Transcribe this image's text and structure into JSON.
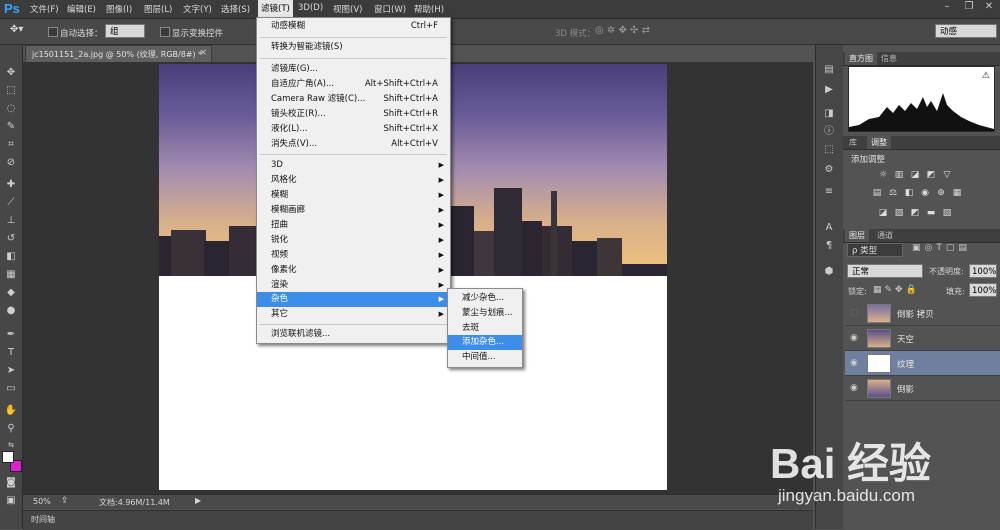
{
  "menubar": {
    "logo": "Ps",
    "items": [
      "文件(F)",
      "编辑(E)",
      "图像(I)",
      "图层(L)",
      "文字(Y)",
      "选择(S)",
      "滤镜(T)",
      "3D(D)",
      "视图(V)",
      "窗口(W)",
      "帮助(H)"
    ],
    "active_index": 6
  },
  "options": {
    "auto_select_label": "自动选择：",
    "auto_select_value": "组",
    "show_transform_label": "显示变换控件",
    "mode_3d_label": "3D 模式：",
    "workspace_value": "动感"
  },
  "document": {
    "tab_title": "jc1501151_2a.jpg @ 50% (纹理, RGB/8#) *",
    "tab_close": "×"
  },
  "statusbar": {
    "zoom": "50%",
    "doc_info": "文档:4.96M/11.4M"
  },
  "timeline": {
    "label": "时间轴"
  },
  "filter_menu": {
    "items": [
      {
        "label": "动感模糊",
        "shortcut": "Ctrl+F"
      },
      {
        "label": "转换为智能滤镜(S)",
        "shortcut": ""
      },
      {
        "label": "滤镜库(G)...",
        "shortcut": ""
      },
      {
        "label": "自适应广角(A)...",
        "shortcut": "Alt+Shift+Ctrl+A"
      },
      {
        "label": "Camera Raw 滤镜(C)...",
        "shortcut": "Shift+Ctrl+A"
      },
      {
        "label": "镜头校正(R)...",
        "shortcut": "Shift+Ctrl+R"
      },
      {
        "label": "液化(L)...",
        "shortcut": "Shift+Ctrl+X"
      },
      {
        "label": "消失点(V)...",
        "shortcut": "Alt+Ctrl+V"
      },
      {
        "label": "3D",
        "shortcut": ""
      },
      {
        "label": "风格化",
        "shortcut": ""
      },
      {
        "label": "模糊",
        "shortcut": ""
      },
      {
        "label": "模糊画廊",
        "shortcut": ""
      },
      {
        "label": "扭曲",
        "shortcut": ""
      },
      {
        "label": "锐化",
        "shortcut": ""
      },
      {
        "label": "视频",
        "shortcut": ""
      },
      {
        "label": "像素化",
        "shortcut": ""
      },
      {
        "label": "渲染",
        "shortcut": ""
      },
      {
        "label": "杂色",
        "shortcut": ""
      },
      {
        "label": "其它",
        "shortcut": ""
      },
      {
        "label": "浏览联机滤镜...",
        "shortcut": ""
      }
    ]
  },
  "noise_submenu": {
    "items": [
      "减少杂色...",
      "蒙尘与划痕...",
      "去斑",
      "添加杂色...",
      "中间值..."
    ],
    "highlight_index": 3
  },
  "panels": {
    "histogram_tabs": [
      "直方图",
      "信息"
    ],
    "adjust_tabs": [
      "库",
      "调整"
    ],
    "adjust_title": "添加调整",
    "layers_tabs": [
      "图层",
      "通道"
    ],
    "kind_filter": "ρ 类型",
    "blend_mode": "正常",
    "opacity_label": "不透明度:",
    "opacity_value": "100%",
    "lock_label": "锁定:",
    "fill_label": "填充:",
    "fill_value": "100%",
    "layers": [
      {
        "name": "倒影 拷贝",
        "visible": false
      },
      {
        "name": "天空",
        "visible": true
      },
      {
        "name": "纹理",
        "visible": true
      },
      {
        "name": "倒影",
        "visible": true
      }
    ],
    "selected_layer_index": 2
  },
  "watermark": {
    "brand": "Bai 经验",
    "url": "jingyan.baidu.com"
  },
  "colors": {
    "menu_highlight": "#3d8ee8",
    "foreground": "#ffffff",
    "background": "#e020d0"
  }
}
